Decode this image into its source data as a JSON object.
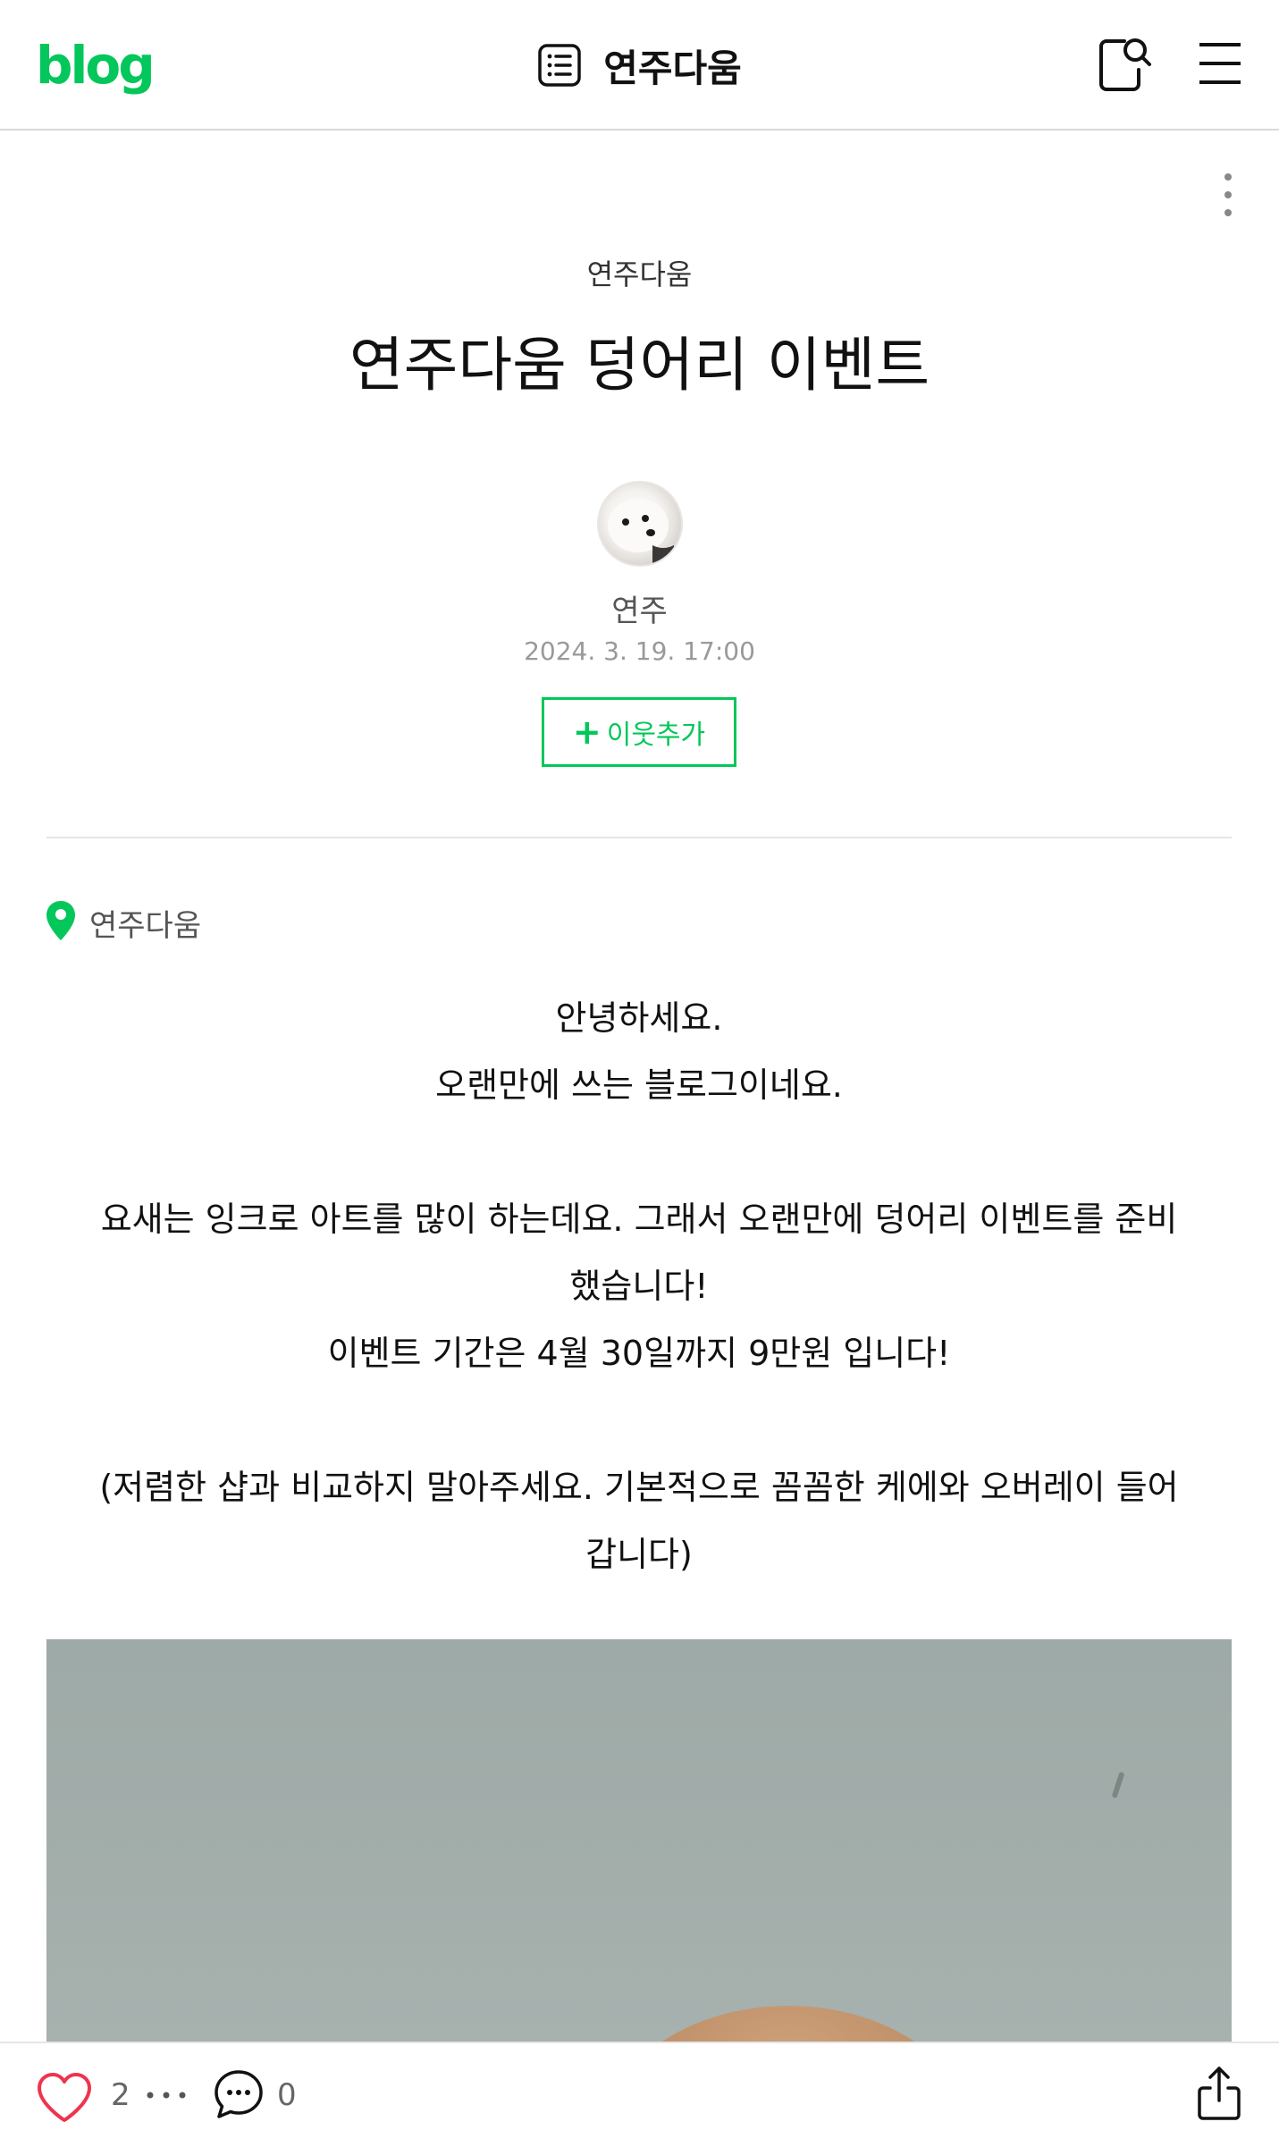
{
  "header": {
    "logo": "blog",
    "blog_title": "연주다움",
    "icons": {
      "list": "post-list-icon",
      "search": "search-icon",
      "menu": "menu-icon"
    },
    "accent_color": "#03c75a"
  },
  "post": {
    "category": "연주다움",
    "title": "연주다움 덩어리 이벤트",
    "author": "연주",
    "date": "2024. 3. 19. 17:00",
    "neighbor_button": {
      "plus": "+",
      "label": "이웃추가"
    },
    "location": "연주다움",
    "content": [
      "안녕하세요.",
      "오랜만에 쓰는 블로그이네요.",
      "",
      "요새는 잉크로 아트를 많이 하는데요. 그래서 오랜만에 덩어리 이벤트를 준비",
      "했습니다!",
      "이벤트 기간은 4월 30일까지 9만원 입니다!",
      "",
      "(저렴한 샵과 비교하지 말아주세요. 기본적으로 꼼꼼한 케에와 오버레이 들어",
      "갑니다)"
    ]
  },
  "bottom_bar": {
    "like_count": "2",
    "comment_count": "0",
    "icons": {
      "like": "heart-icon",
      "more": "more-dots-icon",
      "comment": "comment-icon",
      "share": "share-icon"
    }
  }
}
